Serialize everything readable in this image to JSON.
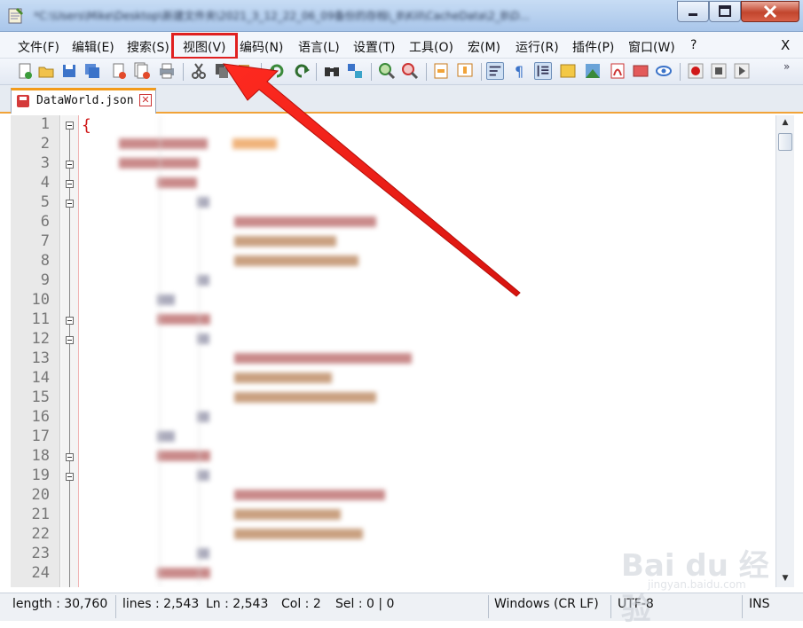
{
  "window": {
    "title": "*C:\\Users\\Mike\\Desktop\\新建文件夹\\2021_3_12_22_06_09备份的存档\\_8\\Kill\\CacheData\\2_B\\D...",
    "min_icon": "minimize-icon",
    "max_icon": "maximize-icon",
    "close_icon": "close-icon"
  },
  "menubar": {
    "items": [
      {
        "label": "文件(F)"
      },
      {
        "label": "编辑(E)"
      },
      {
        "label": "搜索(S)"
      },
      {
        "label": "视图(V)"
      },
      {
        "label": "编码(N)"
      },
      {
        "label": "语言(L)"
      },
      {
        "label": "设置(T)"
      },
      {
        "label": "工具(O)"
      },
      {
        "label": "宏(M)"
      },
      {
        "label": "运行(R)"
      },
      {
        "label": "插件(P)"
      },
      {
        "label": "窗口(W)"
      },
      {
        "label": "?"
      }
    ],
    "close_label": "X",
    "highlight_color": "#e02020"
  },
  "toolbar": {
    "icons": [
      "new-file-icon",
      "open-file-icon",
      "save-icon",
      "save-all-icon",
      "close-file-icon",
      "close-all-icon",
      "print-icon",
      "cut-icon",
      "copy-icon",
      "paste-icon",
      "undo-icon",
      "redo-icon",
      "find-icon",
      "replace-icon",
      "zoom-in-icon",
      "zoom-out-icon",
      "sync-vertical-icon",
      "sync-horizontal-icon",
      "word-wrap-icon",
      "show-all-chars-icon",
      "indent-guide-icon",
      "function-list-icon",
      "doc-map-icon",
      "folder-workspace-icon",
      "monitor-icon",
      "preview-icon",
      "record-macro-icon",
      "stop-macro-icon",
      "play-macro-icon"
    ],
    "more_label": "»"
  },
  "tabs": [
    {
      "label": "DataWorld.json",
      "icon": "save-status-icon",
      "close_label": "✕"
    }
  ],
  "editor": {
    "line_numbers": [
      "1",
      "2",
      "3",
      "4",
      "5",
      "6",
      "7",
      "8",
      "9",
      "10",
      "11",
      "12",
      "13",
      "14",
      "15",
      "16",
      "17",
      "18",
      "19",
      "20",
      "21",
      "22",
      "23",
      "24"
    ],
    "first_line": "{",
    "brace_color": "#d01818"
  },
  "statusbar": {
    "length": "length : 30,760",
    "lines": "lines : 2,543",
    "ln": "Ln : 2,543",
    "col": "Col : 2",
    "sel": "Sel : 0 | 0",
    "eol": "Windows (CR LF)",
    "encoding": "UTF-8",
    "mode": "INS"
  },
  "watermark": {
    "logo": "Bai du 经验",
    "url": "jingyan.baidu.com"
  },
  "annotation": {
    "arrow_color": "#e8201a"
  }
}
